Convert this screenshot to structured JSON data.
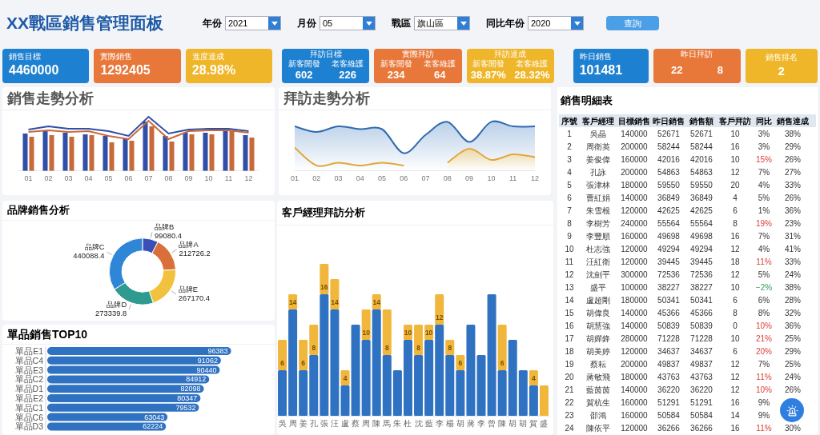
{
  "title": "XX戰區銷售管理面板",
  "filters": [
    {
      "label": "年份",
      "value": "2021"
    },
    {
      "label": "月份",
      "value": "05"
    },
    {
      "label": "戰區",
      "value": "旗山區"
    },
    {
      "label": "同比年份",
      "value": "2020"
    }
  ],
  "query_button": "查詢",
  "kpis": [
    {
      "kind": "single",
      "color": "#1e80d0",
      "label": "銷售目標",
      "value": "4460000"
    },
    {
      "kind": "single",
      "color": "#e8773a",
      "label": "實際銷售",
      "value": "1292405"
    },
    {
      "kind": "single",
      "color": "#f0b62a",
      "label": "進度達成",
      "value": "28.98%"
    },
    {
      "kind": "double",
      "color": "#1e80d0",
      "label": "拜訪目標",
      "parts": [
        {
          "label": "新客開發",
          "value": "602"
        },
        {
          "label": "老客維護",
          "value": "226"
        }
      ]
    },
    {
      "kind": "double",
      "color": "#e8773a",
      "label": "實際拜訪",
      "parts": [
        {
          "label": "新客開發",
          "value": "234"
        },
        {
          "label": "老客維護",
          "value": "64"
        }
      ]
    },
    {
      "kind": "double",
      "color": "#f0b62a",
      "label": "拜訪達成",
      "parts": [
        {
          "label": "新客開發",
          "value": "38.87%"
        },
        {
          "label": "老客維護",
          "value": "28.32%"
        }
      ]
    },
    {
      "kind": "single",
      "color": "#1e80d0",
      "label": "昨日銷售",
      "value": "101481"
    },
    {
      "kind": "double",
      "color": "#e8773a",
      "label": "昨日拜訪",
      "parts": [
        {
          "value": "22"
        },
        {
          "value": "8"
        }
      ]
    },
    {
      "kind": "centered",
      "color": "#f0b62a",
      "label": "銷售排名",
      "value": "2"
    }
  ],
  "sales_trend": {
    "title": "銷售走勢分析",
    "months": [
      "01",
      "02",
      "03",
      "04",
      "05",
      "06",
      "07",
      "08",
      "09",
      "10",
      "11",
      "12"
    ]
  },
  "visit_trend": {
    "title": "拜訪走勢分析",
    "months": [
      "01",
      "02",
      "03",
      "04",
      "05",
      "06",
      "07",
      "08",
      "09",
      "10",
      "11",
      "12"
    ]
  },
  "brand_sales": {
    "title": "品牌銷售分析",
    "chart_data": {
      "type": "donut",
      "categories": [
        "品牌B",
        "品牌A",
        "品牌E",
        "品牌D",
        "品牌C"
      ],
      "values": [
        99080.4,
        212726.2,
        267170.4,
        273339.8,
        440088.4
      ],
      "data_labels": true,
      "colors": [
        "#3b4fb8",
        "#d9703a",
        "#f2c23e",
        "#2f9a8f",
        "#2f86d6"
      ]
    }
  },
  "top10": {
    "title": "單品銷售TOP10",
    "chart_data": {
      "type": "bar",
      "orientation": "horizontal",
      "categories": [
        "單品E1",
        "單品C4",
        "單品E3",
        "單品C2",
        "單品D1",
        "單品E2",
        "單品C1",
        "單品C6",
        "單品D3"
      ],
      "values": [
        96383,
        91062,
        90440,
        84912,
        82098,
        80347,
        79532,
        63043,
        62224
      ],
      "data_labels": true
    }
  },
  "manager_visits": {
    "title": "客戶經理拜訪分析",
    "bars": [
      {
        "axis_label": "吳",
        "value_label": "6"
      },
      {
        "axis_label": "周",
        "value_label": "14"
      },
      {
        "axis_label": "姜",
        "value_label": "6"
      },
      {
        "axis_label": "孔",
        "value_label": "8"
      },
      {
        "axis_label": "張",
        "value_label": "16"
      },
      {
        "axis_label": "汪",
        "value_label": "14"
      },
      {
        "axis_label": "盧",
        "value_label": "4"
      },
      {
        "axis_label": "蔡"
      },
      {
        "axis_label": "周",
        "value_label": "10"
      },
      {
        "axis_label": "陳",
        "value_label": "14"
      },
      {
        "axis_label": "馬",
        "value_label": "8"
      },
      {
        "axis_label": "朱"
      },
      {
        "axis_label": "杜",
        "value_label": "10"
      },
      {
        "axis_label": "沈",
        "value_label": "8"
      },
      {
        "axis_label": "藍",
        "value_label": "10"
      },
      {
        "axis_label": "李",
        "value_label": "12"
      },
      {
        "axis_label": "楊",
        "value_label": "8"
      },
      {
        "axis_label": "胡",
        "value_label": "6"
      },
      {
        "axis_label": "蔣"
      },
      {
        "axis_label": "李"
      },
      {
        "axis_label": "曾"
      },
      {
        "axis_label": "陳",
        "value_label": "6"
      },
      {
        "axis_label": "胡"
      },
      {
        "axis_label": "胡"
      },
      {
        "axis_label": "賀",
        "value_label": "4"
      },
      {
        "axis_label": "盛"
      }
    ]
  },
  "detail_table": {
    "title": "銷售明細表",
    "columns": [
      "序號",
      "客戶經理",
      "目標銷售",
      "昨日銷售",
      "銷售額",
      "客戶拜訪",
      "同比",
      "銷售達成"
    ],
    "rows": [
      {
        "cells": [
          "1",
          "吳晶",
          "140000",
          "52671",
          "52671",
          "10",
          "3%",
          "38%"
        ],
        "alert": false,
        "decline": false
      },
      {
        "cells": [
          "2",
          "周衛英",
          "200000",
          "58244",
          "58244",
          "16",
          "3%",
          "29%"
        ],
        "alert": false,
        "decline": false
      },
      {
        "cells": [
          "3",
          "姜俊偉",
          "160000",
          "42016",
          "42016",
          "10",
          "15%",
          "26%"
        ],
        "alert": true,
        "decline": false
      },
      {
        "cells": [
          "4",
          "孔詠",
          "200000",
          "54863",
          "54863",
          "12",
          "7%",
          "27%"
        ],
        "alert": false,
        "decline": false
      },
      {
        "cells": [
          "5",
          "張津林",
          "180000",
          "59550",
          "59550",
          "20",
          "4%",
          "33%"
        ],
        "alert": false,
        "decline": false
      },
      {
        "cells": [
          "6",
          "曹紅娟",
          "140000",
          "36849",
          "36849",
          "4",
          "5%",
          "26%"
        ],
        "alert": false,
        "decline": false
      },
      {
        "cells": [
          "7",
          "朱雪根",
          "120000",
          "42625",
          "42625",
          "6",
          "1%",
          "36%"
        ],
        "alert": false,
        "decline": false
      },
      {
        "cells": [
          "8",
          "李樹芳",
          "240000",
          "55564",
          "55564",
          "8",
          "19%",
          "23%"
        ],
        "alert": true,
        "decline": false
      },
      {
        "cells": [
          "9",
          "李豐順",
          "160000",
          "49698",
          "49698",
          "16",
          "7%",
          "31%"
        ],
        "alert": false,
        "decline": false
      },
      {
        "cells": [
          "10",
          "杜志強",
          "120000",
          "49294",
          "49294",
          "12",
          "4%",
          "41%"
        ],
        "alert": false,
        "decline": false
      },
      {
        "cells": [
          "11",
          "汪紅衛",
          "120000",
          "39445",
          "39445",
          "18",
          "11%",
          "33%"
        ],
        "alert": true,
        "decline": false
      },
      {
        "cells": [
          "12",
          "沈劍平",
          "300000",
          "72536",
          "72536",
          "12",
          "5%",
          "24%"
        ],
        "alert": false,
        "decline": false
      },
      {
        "cells": [
          "13",
          "盛平",
          "100000",
          "38227",
          "38227",
          "10",
          "−2%",
          "38%"
        ],
        "alert": false,
        "decline": true
      },
      {
        "cells": [
          "14",
          "盧超剛",
          "180000",
          "50341",
          "50341",
          "6",
          "6%",
          "28%"
        ],
        "alert": false,
        "decline": false
      },
      {
        "cells": [
          "15",
          "胡偉良",
          "140000",
          "45366",
          "45366",
          "8",
          "8%",
          "32%"
        ],
        "alert": false,
        "decline": false
      },
      {
        "cells": [
          "16",
          "胡慧強",
          "140000",
          "50839",
          "50839",
          "0",
          "10%",
          "36%"
        ],
        "alert": true,
        "decline": false
      },
      {
        "cells": [
          "17",
          "胡嬋鋒",
          "280000",
          "71228",
          "71228",
          "10",
          "21%",
          "25%"
        ],
        "alert": true,
        "decline": false
      },
      {
        "cells": [
          "18",
          "胡美婷",
          "120000",
          "34637",
          "34637",
          "6",
          "20%",
          "29%"
        ],
        "alert": true,
        "decline": false
      },
      {
        "cells": [
          "19",
          "蔡耘",
          "200000",
          "49837",
          "49837",
          "12",
          "7%",
          "25%"
        ],
        "alert": false,
        "decline": false
      },
      {
        "cells": [
          "20",
          "蔣敏飛",
          "180000",
          "43763",
          "43763",
          "12",
          "11%",
          "24%"
        ],
        "alert": true,
        "decline": false
      },
      {
        "cells": [
          "21",
          "藍茵茵",
          "140000",
          "36220",
          "36220",
          "12",
          "10%",
          "26%"
        ],
        "alert": true,
        "decline": false
      },
      {
        "cells": [
          "22",
          "賀杭生",
          "160000",
          "51291",
          "51291",
          "16",
          "9%"
        ],
        "alert": false,
        "decline": false
      },
      {
        "cells": [
          "23",
          "邵鴻",
          "160000",
          "50584",
          "50584",
          "14",
          "9%"
        ],
        "alert": false,
        "decline": false
      },
      {
        "cells": [
          "24",
          "陳依平",
          "120000",
          "36266",
          "36266",
          "16",
          "11%",
          "30%"
        ],
        "alert": true,
        "decline": false
      }
    ]
  }
}
